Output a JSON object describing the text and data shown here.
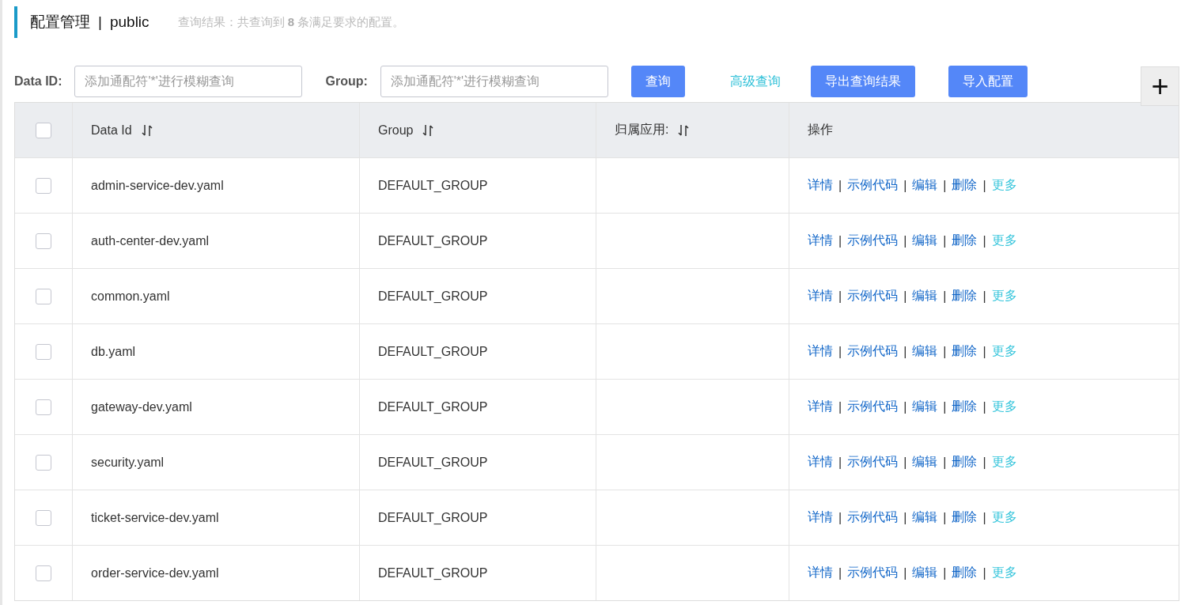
{
  "header": {
    "title": "配置管理",
    "separator": "|",
    "namespace": "public",
    "summary": "查询结果：共查询到 **8** 条满足要求的配置。"
  },
  "filters": [
    {
      "label": "Data ID:",
      "placeholder": "添加通配符'*'进行模糊查询"
    },
    {
      "label": "Group:",
      "placeholder": "添加通配符'*'进行模糊查询"
    }
  ],
  "toolbar": [
    {
      "kind": "primary",
      "label": "查询"
    },
    {
      "kind": "link",
      "label": "高级查询"
    },
    {
      "kind": "primary",
      "label": "导出查询结果"
    },
    {
      "kind": "primary",
      "label": "导入配置"
    },
    {
      "kind": "add",
      "label": "+"
    }
  ],
  "table": {
    "select_all": {
      "checked": false
    },
    "columns": [
      {
        "label": "Data Id",
        "sortable": true
      },
      {
        "label": "Group",
        "sortable": true
      },
      {
        "label": "归属应用:",
        "sortable": true
      },
      {
        "label": "操作",
        "sortable": false
      }
    ],
    "rows": [
      {
        "checked": false,
        "data_id": "admin-service-dev.yaml",
        "group": "DEFAULT_GROUP",
        "actions": [
          {
            "kind": "link",
            "label": "详情"
          },
          {
            "kind": "separator",
            "label": "|"
          },
          {
            "kind": "link",
            "label": "示例代码"
          },
          {
            "kind": "separator",
            "label": "|"
          },
          {
            "kind": "link",
            "label": "编辑"
          },
          {
            "kind": "separator",
            "label": "|"
          },
          {
            "kind": "link",
            "label": "删除"
          },
          {
            "kind": "separator",
            "label": "|"
          },
          {
            "kind": "more",
            "label": "更多"
          }
        ]
      },
      {
        "checked": false,
        "data_id": "auth-center-dev.yaml",
        "group": "DEFAULT_GROUP",
        "actions": [
          {
            "kind": "link",
            "label": "详情"
          },
          {
            "kind": "separator",
            "label": "|"
          },
          {
            "kind": "link",
            "label": "示例代码"
          },
          {
            "kind": "separator",
            "label": "|"
          },
          {
            "kind": "link",
            "label": "编辑"
          },
          {
            "kind": "separator",
            "label": "|"
          },
          {
            "kind": "link",
            "label": "删除"
          },
          {
            "kind": "separator",
            "label": "|"
          },
          {
            "kind": "more",
            "label": "更多"
          }
        ]
      },
      {
        "checked": false,
        "data_id": "common.yaml",
        "group": "DEFAULT_GROUP",
        "actions": [
          {
            "kind": "link",
            "label": "详情"
          },
          {
            "kind": "separator",
            "label": "|"
          },
          {
            "kind": "link",
            "label": "示例代码"
          },
          {
            "kind": "separator",
            "label": "|"
          },
          {
            "kind": "link",
            "label": "编辑"
          },
          {
            "kind": "separator",
            "label": "|"
          },
          {
            "kind": "link",
            "label": "删除"
          },
          {
            "kind": "separator",
            "label": "|"
          },
          {
            "kind": "more",
            "label": "更多"
          }
        ]
      },
      {
        "checked": false,
        "data_id": "db.yaml",
        "group": "DEFAULT_GROUP",
        "actions": [
          {
            "kind": "link",
            "label": "详情"
          },
          {
            "kind": "separator",
            "label": "|"
          },
          {
            "kind": "link",
            "label": "示例代码"
          },
          {
            "kind": "separator",
            "label": "|"
          },
          {
            "kind": "link",
            "label": "编辑"
          },
          {
            "kind": "separator",
            "label": "|"
          },
          {
            "kind": "link",
            "label": "删除"
          },
          {
            "kind": "separator",
            "label": "|"
          },
          {
            "kind": "more",
            "label": "更多"
          }
        ]
      },
      {
        "checked": false,
        "data_id": "gateway-dev.yaml",
        "group": "DEFAULT_GROUP",
        "actions": [
          {
            "kind": "link",
            "label": "详情"
          },
          {
            "kind": "separator",
            "label": "|"
          },
          {
            "kind": "link",
            "label": "示例代码"
          },
          {
            "kind": "separator",
            "label": "|"
          },
          {
            "kind": "link",
            "label": "编辑"
          },
          {
            "kind": "separator",
            "label": "|"
          },
          {
            "kind": "link",
            "label": "删除"
          },
          {
            "kind": "separator",
            "label": "|"
          },
          {
            "kind": "more",
            "label": "更多"
          }
        ]
      },
      {
        "checked": false,
        "data_id": "security.yaml",
        "group": "DEFAULT_GROUP",
        "actions": [
          {
            "kind": "link",
            "label": "详情"
          },
          {
            "kind": "separator",
            "label": "|"
          },
          {
            "kind": "link",
            "label": "示例代码"
          },
          {
            "kind": "separator",
            "label": "|"
          },
          {
            "kind": "link",
            "label": "编辑"
          },
          {
            "kind": "separator",
            "label": "|"
          },
          {
            "kind": "link",
            "label": "删除"
          },
          {
            "kind": "separator",
            "label": "|"
          },
          {
            "kind": "more",
            "label": "更多"
          }
        ]
      },
      {
        "checked": false,
        "data_id": "ticket-service-dev.yaml",
        "group": "DEFAULT_GROUP",
        "actions": [
          {
            "kind": "link",
            "label": "详情"
          },
          {
            "kind": "separator",
            "label": "|"
          },
          {
            "kind": "link",
            "label": "示例代码"
          },
          {
            "kind": "separator",
            "label": "|"
          },
          {
            "kind": "link",
            "label": "编辑"
          },
          {
            "kind": "separator",
            "label": "|"
          },
          {
            "kind": "link",
            "label": "删除"
          },
          {
            "kind": "separator",
            "label": "|"
          },
          {
            "kind": "more",
            "label": "更多"
          }
        ]
      },
      {
        "checked": false,
        "data_id": "order-service-dev.yaml",
        "group": "DEFAULT_GROUP",
        "actions": [
          {
            "kind": "link",
            "label": "详情"
          },
          {
            "kind": "separator",
            "label": "|"
          },
          {
            "kind": "link",
            "label": "示例代码"
          },
          {
            "kind": "separator",
            "label": "|"
          },
          {
            "kind": "link",
            "label": "编辑"
          },
          {
            "kind": "separator",
            "label": "|"
          },
          {
            "kind": "link",
            "label": "删除"
          },
          {
            "kind": "separator",
            "label": "|"
          },
          {
            "kind": "more",
            "label": "更多"
          }
        ]
      }
    ]
  }
}
